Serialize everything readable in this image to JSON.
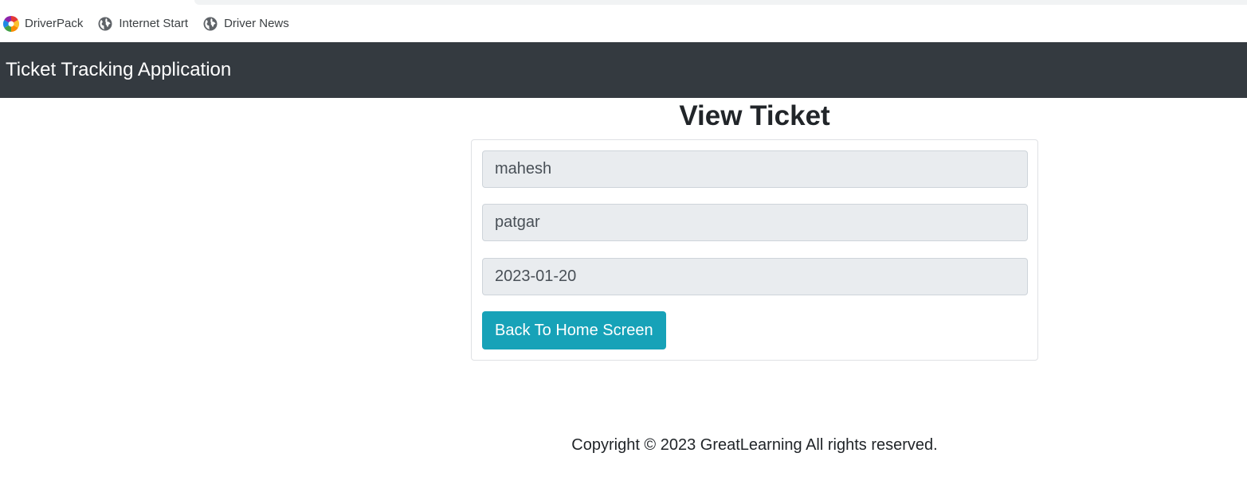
{
  "bookmarks": [
    {
      "label": "DriverPack",
      "icon": "driverpack-logo-icon"
    },
    {
      "label": "Internet Start",
      "icon": "globe-icon"
    },
    {
      "label": "Driver News",
      "icon": "globe-icon"
    }
  ],
  "navbar": {
    "brand": "Ticket Tracking Application"
  },
  "page": {
    "title": "View Ticket"
  },
  "form": {
    "field1_value": "mahesh",
    "field2_value": "patgar",
    "field3_value": "2023-01-20",
    "back_button_label": "Back To Home Screen"
  },
  "footer": {
    "text": "Copyright © 2023 GreatLearning All rights reserved."
  },
  "colors": {
    "navbar_bg": "#343a40",
    "button_bg": "#17a2b8",
    "input_bg": "#e9ecef"
  }
}
